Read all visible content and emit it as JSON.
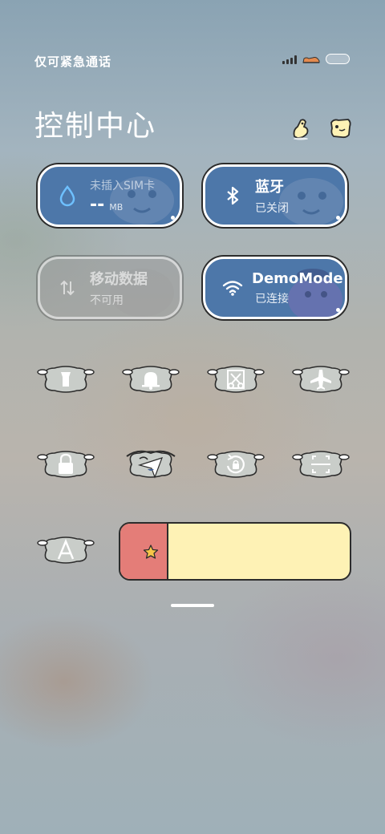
{
  "status_bar": {
    "carrier_text": "仅可紧急通话",
    "signal_levels": [
      0.3,
      0.5,
      0.7,
      1.0
    ]
  },
  "header": {
    "title": "控制中心",
    "icons": [
      "edit-icon",
      "settings-icon"
    ]
  },
  "tiles": {
    "mobile_data_usage": {
      "title": "未插入SIM卡",
      "value": "--",
      "unit": "MB",
      "icon": "water-drop-icon",
      "color": "#4d77a9"
    },
    "bluetooth": {
      "title": "蓝牙",
      "status": "已关闭",
      "icon": "bluetooth-icon",
      "color": "#4d77a9"
    },
    "mobile_data": {
      "title": "移动数据",
      "status": "不可用",
      "icon": "data-arrows-icon",
      "enabled": false
    },
    "wifi": {
      "title": "DemoMode",
      "status": "已连接",
      "icon": "wifi-icon",
      "color": "#4d77a9"
    }
  },
  "toggles": [
    {
      "id": "flashlight",
      "icon": "flashlight-icon"
    },
    {
      "id": "silent",
      "icon": "bell-icon"
    },
    {
      "id": "screenshot",
      "icon": "scissors-icon"
    },
    {
      "id": "airplane",
      "icon": "airplane-icon"
    },
    {
      "id": "lock",
      "icon": "lock-icon"
    },
    {
      "id": "location",
      "icon": "location-icon"
    },
    {
      "id": "rotation",
      "icon": "rotation-lock-icon"
    },
    {
      "id": "scan",
      "icon": "scan-icon"
    },
    {
      "id": "auto_brightness",
      "icon": "auto-brightness-icon"
    }
  ],
  "brightness": {
    "level": 0.21,
    "fill_color": "#e47d78",
    "track_color": "#fef2b5",
    "icon": "star-sun-icon"
  }
}
